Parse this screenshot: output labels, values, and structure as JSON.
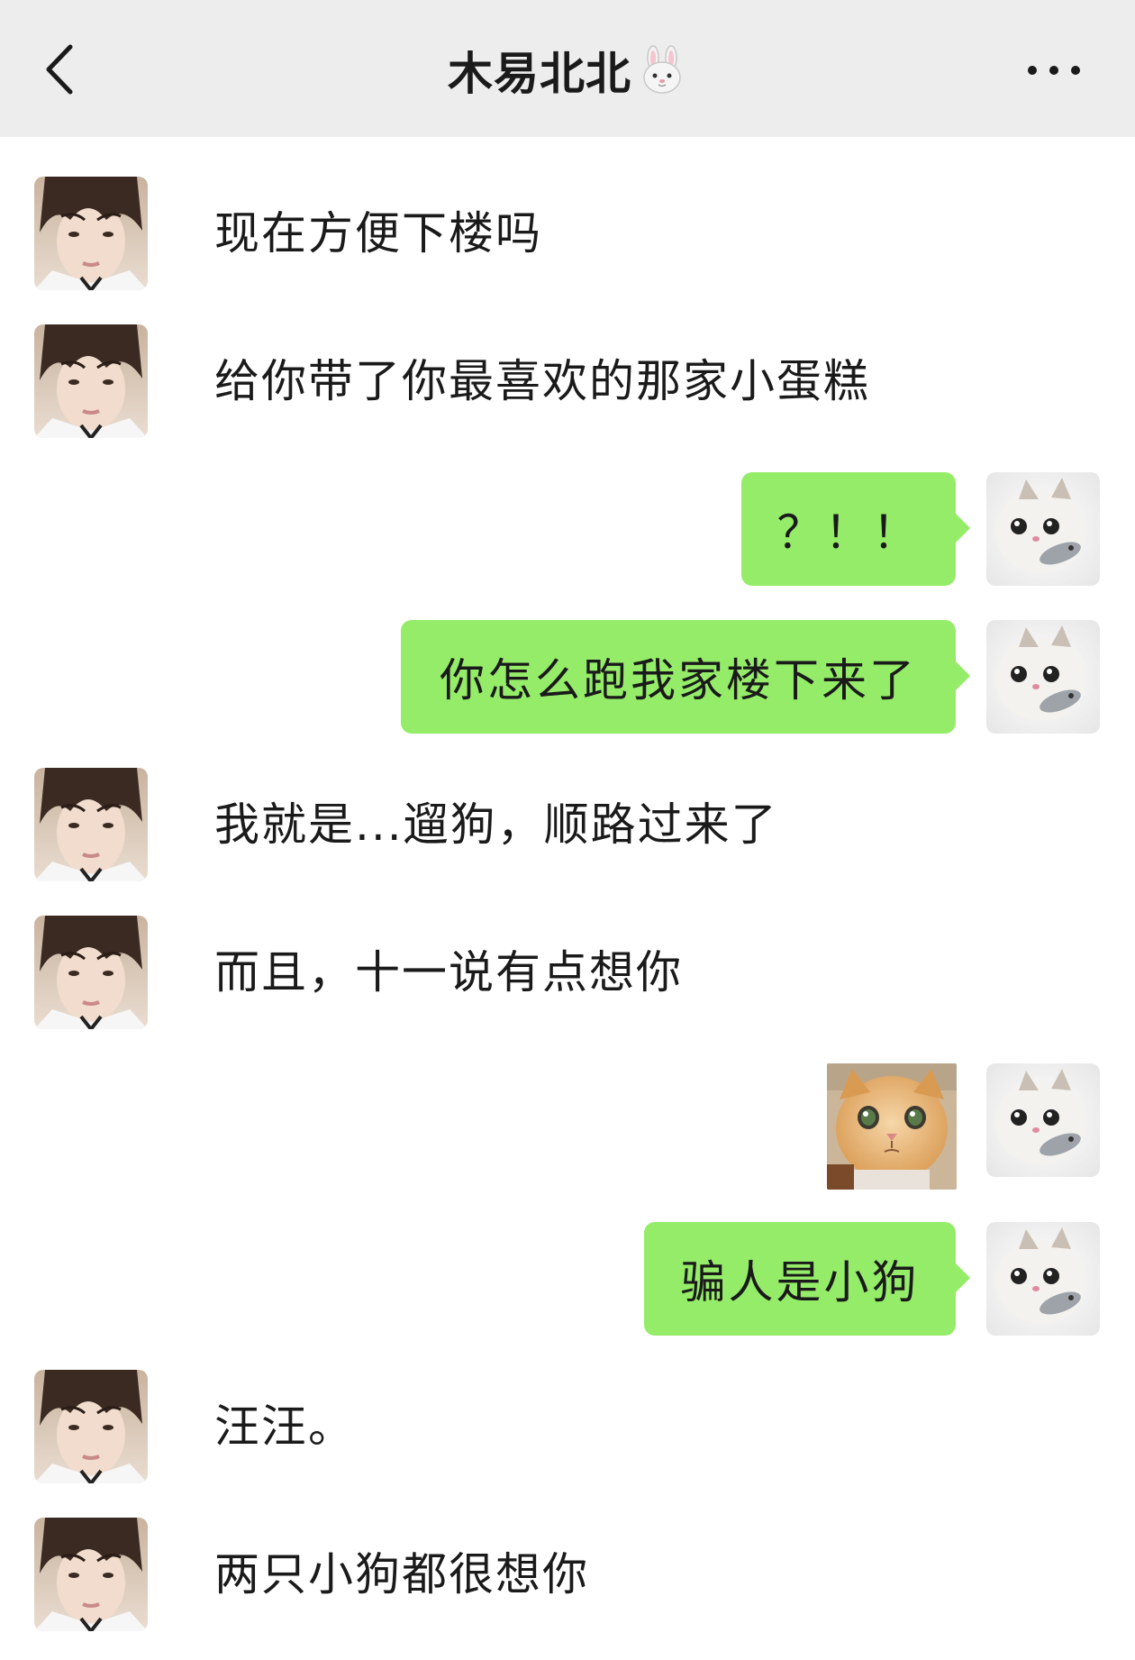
{
  "header": {
    "title": "木易北北",
    "back_icon": "chevron-left-icon",
    "title_emoji": "rabbit-face-icon",
    "more_icon": "ellipsis-icon"
  },
  "messages": [
    {
      "side": "left",
      "text": "现在方便下楼吗"
    },
    {
      "side": "left",
      "text": "给你带了你最喜欢的那家小蛋糕"
    },
    {
      "side": "right",
      "text": "？！！"
    },
    {
      "side": "right",
      "text": "你怎么跑我家楼下来了"
    },
    {
      "side": "left",
      "text": "我就是...遛狗，顺路过来了"
    },
    {
      "side": "left",
      "text": "而且，十一说有点想你"
    },
    {
      "side": "right",
      "type": "sticker",
      "sticker": "orange-cat-sticker"
    },
    {
      "side": "right",
      "text": "骗人是小狗"
    },
    {
      "side": "left",
      "text": "汪汪。"
    },
    {
      "side": "left",
      "text": "两只小狗都很想你"
    }
  ],
  "colors": {
    "header_bg": "#ededed",
    "bubble_green": "#95ec69",
    "chat_bg": "#ffffff"
  }
}
